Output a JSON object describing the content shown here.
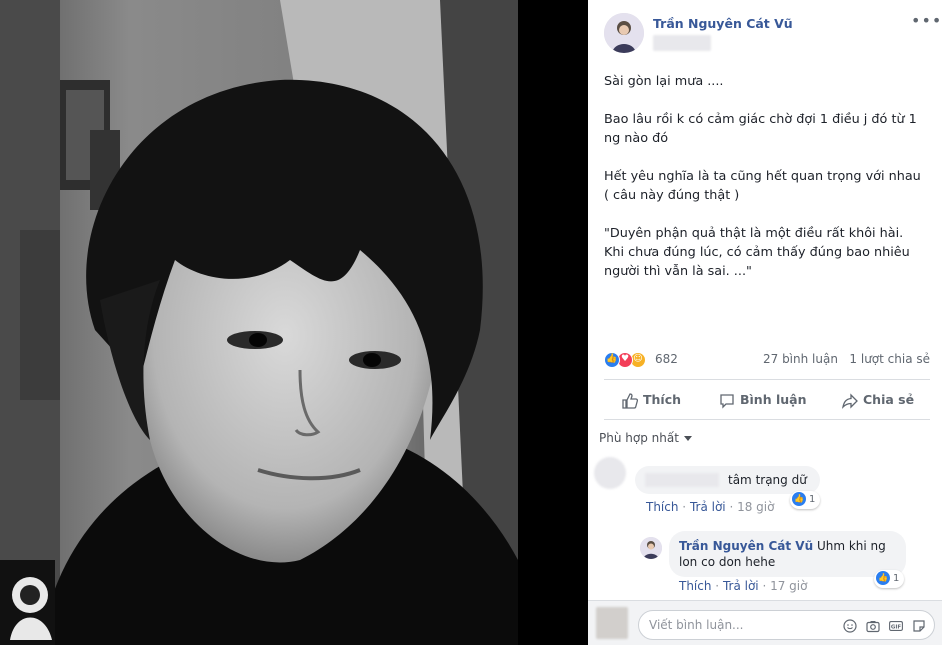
{
  "post": {
    "author": "Trần Nguyên Cát Vũ",
    "caption": [
      "Sài gòn lại mưa ....",
      "Bao lâu rồi k có cảm giác chờ đợi 1 điều j đó từ 1\nng nào đó",
      "Hết yêu nghĩa là ta cũng hết quan trọng với nhau\n( câu này đúng thật )",
      "\"Duyên phận quả thật là một điều rất khôi hài.\nKhi chưa đúng lúc, có cảm thấy đúng bao nhiêu\nngười thì vẫn là sai. ...\""
    ],
    "reaction_count": "682",
    "comments_count": "27 bình luận",
    "shares_count": "1 lượt chia sẻ"
  },
  "actions": {
    "like": "Thích",
    "comment": "Bình luận",
    "share": "Chia sẻ"
  },
  "sort_label": "Phù hợp nhất",
  "comments": [
    {
      "text": "tâm trạng dữ",
      "like": "Thích",
      "reply": "Trả lời",
      "time": "18 giờ",
      "likes": "1"
    }
  ],
  "reply": {
    "author": "Trần Nguyên Cát Vũ",
    "text_line1": "Uhm khi ng",
    "text_line2": "lon co don hehe",
    "like": "Thích",
    "reply": "Trả lời",
    "time": "17 giờ",
    "likes": "1"
  },
  "input": {
    "placeholder": "Viết bình luận..."
  },
  "icons": [
    "more-icon",
    "like-icon",
    "comment-icon",
    "share-icon",
    "emoji-icon",
    "camera-icon",
    "gif-icon",
    "sticker-icon"
  ],
  "colors": {
    "link": "#385898",
    "meta": "#90949c",
    "like_blue": "#2a7ef0",
    "love_red": "#f33e58",
    "haha_yellow": "#f7b125"
  }
}
